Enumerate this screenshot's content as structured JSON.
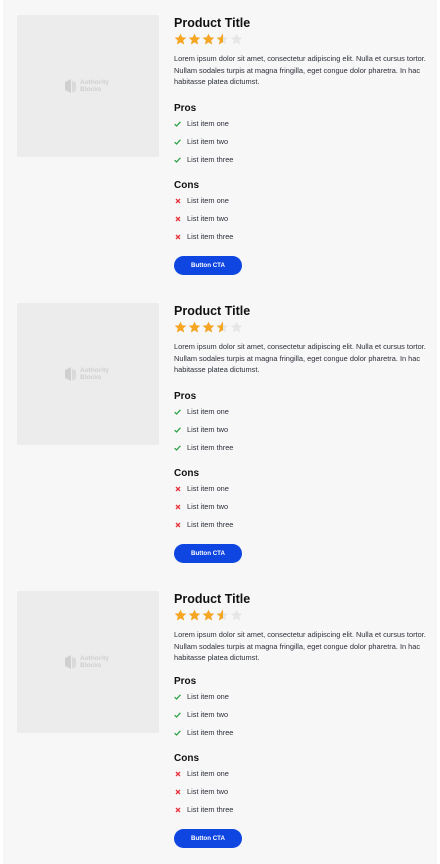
{
  "colors": {
    "star_filled": "#f5a623",
    "star_empty": "#e6e6e6",
    "check": "#2ea043",
    "cross": "#e5343a",
    "button": "#0f45e0"
  },
  "products": [
    {
      "title": "Product Title",
      "rating": 3.5,
      "rating_max": 5,
      "image_logo": "Authority\nBlocks",
      "description": "Lorem ipsum dolor sit amet, consectetur adipiscing elit. Nulla et cursus tortor. Nullam sodales turpis at magna fringilla, eget congue dolor pharetra. In hac habitasse platea dictumst.",
      "pros_heading": "Pros",
      "pros": [
        "List item one",
        "List item two",
        "List item three"
      ],
      "cons_heading": "Cons",
      "cons": [
        "List item one",
        "List item two",
        "List item three"
      ],
      "cta_label": "Button CTA"
    },
    {
      "title": "Product Title",
      "rating": 3.5,
      "rating_max": 5,
      "image_logo": "Authority\nBlocks",
      "description": "Lorem ipsum dolor sit amet, consectetur adipiscing elit. Nulla et cursus tortor. Nullam sodales turpis at magna fringilla, eget congue dolor pharetra. In hac habitasse platea dictumst.",
      "pros_heading": "Pros",
      "pros": [
        "List item one",
        "List item two",
        "List item three"
      ],
      "cons_heading": "Cons",
      "cons": [
        "List item one",
        "List item two",
        "List item three"
      ],
      "cta_label": "Button CTA"
    },
    {
      "title": "Product Title",
      "rating": 3.5,
      "rating_max": 5,
      "image_logo": "Authority\nBlocks",
      "description": "Lorem ipsum dolor sit amet, consectetur adipiscing elit. Nulla et cursus tortor. Nullam sodales turpis at magna fringilla, eget congue dolor pharetra. In hac habitasse platea dictumst.",
      "pros_heading": "Pros",
      "pros": [
        "List item one",
        "List item two",
        "List item three"
      ],
      "cons_heading": "Cons",
      "cons": [
        "List item one",
        "List item two",
        "List item three"
      ],
      "cta_label": "Button CTA"
    }
  ]
}
